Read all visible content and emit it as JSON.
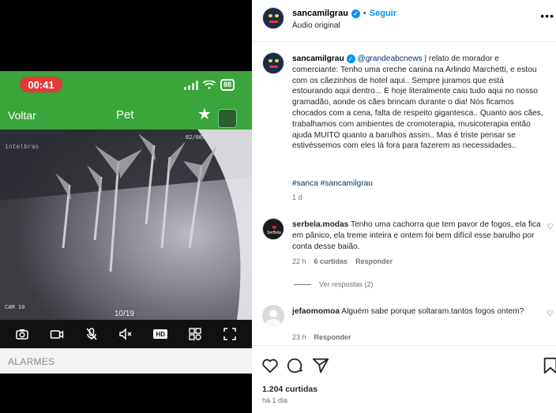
{
  "phone": {
    "time": "00:41",
    "battery": "88",
    "nav": {
      "back": "Voltar",
      "title": "Pet"
    },
    "camera": {
      "timestamp": "02/08/2025 00:34:31",
      "brand": "intelbras",
      "label": "CAM 10",
      "page": "10/19"
    },
    "controls": [
      {
        "icon": "camera-icon"
      },
      {
        "icon": "video-record-icon"
      },
      {
        "icon": "mic-muted-icon"
      },
      {
        "icon": "speaker-muted-icon"
      },
      {
        "icon": "hd-quality-icon",
        "text": "HD"
      },
      {
        "icon": "grid-view-icon"
      },
      {
        "icon": "fullscreen-icon"
      }
    ],
    "alarms": "ALARMES"
  },
  "post": {
    "header": {
      "username": "sancamilgrau",
      "separator": "•",
      "follow": "Seguir",
      "audio": "Áudio original",
      "more": "•••"
    },
    "caption": {
      "username": "sancamilgrau",
      "mention": "@grandeabcnews",
      "text": " | relato de morador e comerciante: Tenho uma creche canina na Arlindo Marchetti, e estou com os cãezinhos de hotel aqui.. Sempre juramos que está estourando aqui dentro... E hoje literalmente caiu tudo aqui no nosso gramadão, aonde os cães brincam durante o dia! Nós ficamos chocados com a cena, falta de respeito gigantesca.. Quanto aos cães, trabalhamos com ambientes de cromoterapia, musicoterapia então ajuda MUITO quanto a barulhos assim.. Mas é triste pensar se estivéssemos com eles lá fora para fazerem as necessidades..",
      "hashtags": "#sanca #sancamilgrau",
      "time": "1 d"
    },
    "comments": [
      {
        "username": "serbela.modas",
        "text": " Tenho uma cachorra que tem pavor de fogos, ela fica em pânico, ela treme inteira e ontem foi bem difícil esse barulho por conta desse baião.",
        "time": "22 h",
        "likes": "6 curtidas",
        "reply": "Responder",
        "view_replies": "Ver respostas (2)"
      },
      {
        "username": "jefaomomoa",
        "text": " Alguém sabe porque soltaram.tantos fogos ontem?",
        "time": "23 h",
        "reply": "Responder"
      }
    ],
    "likes": "1.204 curtidas",
    "ago": "há 1 dia"
  }
}
